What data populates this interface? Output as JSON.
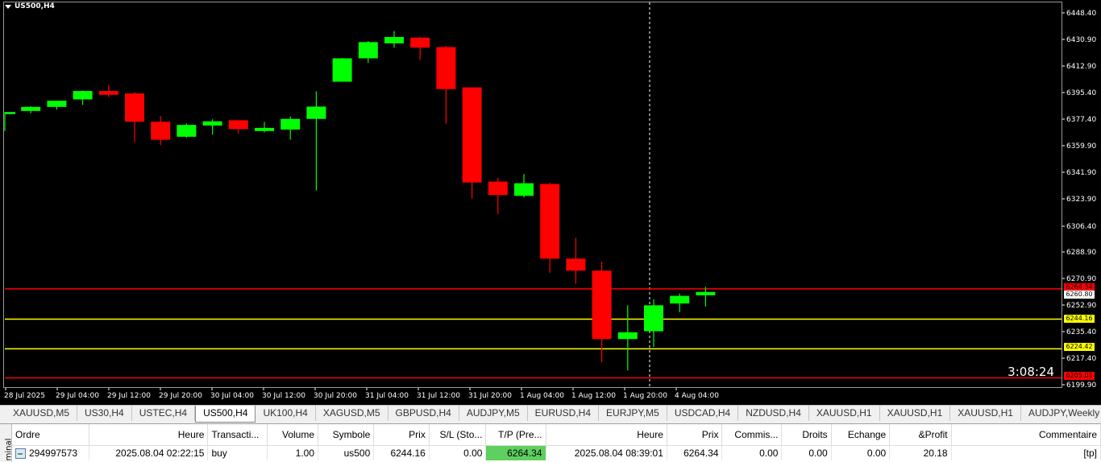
{
  "chart": {
    "symbol_label": "US500,H4",
    "timer": "3:08:24",
    "colors": {
      "bull": "#00ff00",
      "bear": "#ff0000",
      "tp_line": "#ff0000",
      "entry_line": "#ffff00",
      "bg": "#000000",
      "grid_text": "#ffffff"
    },
    "price_axis": [
      "6448.40",
      "6430.90",
      "6412.90",
      "6395.40",
      "6377.40",
      "6359.90",
      "6341.90",
      "6323.90",
      "6306.40",
      "6288.90",
      "6270.90",
      "6252.90",
      "6235.40",
      "6217.40",
      "6199.90"
    ],
    "time_axis": [
      "28 Jul 2025",
      "29 Jul 04:00",
      "29 Jul 12:00",
      "29 Jul 20:00",
      "30 Jul 04:00",
      "30 Jul 12:00",
      "30 Jul 20:00",
      "31 Jul 04:00",
      "31 Jul 12:00",
      "31 Jul 20:00",
      "1 Aug 04:00",
      "1 Aug 12:00",
      "1 Aug 20:00",
      "4 Aug 04:00"
    ],
    "price_tags": {
      "tp": "6264.34",
      "current": "6260.80",
      "entry": "6244.16",
      "level2": "6224.42",
      "sl": "6205.01"
    },
    "chart_data": {
      "type": "candlestick",
      "candles": [
        {
          "o": 6380.9,
          "h": 6382.1,
          "l": 6369.7,
          "c": 6382.3
        },
        {
          "o": 6383.0,
          "h": 6386.1,
          "l": 6381.5,
          "c": 6385.7
        },
        {
          "o": 6385.7,
          "h": 6388.9,
          "l": 6383.9,
          "c": 6389.8
        },
        {
          "o": 6390.7,
          "h": 6396.6,
          "l": 6387.0,
          "c": 6396.3
        },
        {
          "o": 6396.3,
          "h": 6400.4,
          "l": 6392.2,
          "c": 6393.8
        },
        {
          "o": 6394.7,
          "h": 6395.6,
          "l": 6362.1,
          "c": 6375.8
        },
        {
          "o": 6375.8,
          "h": 6379.7,
          "l": 6360.2,
          "c": 6363.8
        },
        {
          "o": 6365.8,
          "h": 6374.6,
          "l": 6365.2,
          "c": 6373.7
        },
        {
          "o": 6373.3,
          "h": 6377.4,
          "l": 6367.2,
          "c": 6376.1
        },
        {
          "o": 6376.8,
          "h": 6376.5,
          "l": 6368.0,
          "c": 6370.9
        },
        {
          "o": 6369.6,
          "h": 6375.7,
          "l": 6368.7,
          "c": 6371.7
        },
        {
          "o": 6370.6,
          "h": 6379.4,
          "l": 6363.9,
          "c": 6377.7
        },
        {
          "o": 6377.7,
          "h": 6396.1,
          "l": 6330.0,
          "c": 6385.9
        },
        {
          "o": 6402.5,
          "h": 6418.3,
          "l": 6403.7,
          "c": 6418.1
        },
        {
          "o": 6418.1,
          "h": 6429.6,
          "l": 6415.1,
          "c": 6428.9
        },
        {
          "o": 6428.1,
          "h": 6436.3,
          "l": 6425.3,
          "c": 6432.3
        },
        {
          "o": 6431.9,
          "h": 6432.4,
          "l": 6417.1,
          "c": 6425.2
        },
        {
          "o": 6425.6,
          "h": 6426.4,
          "l": 6374.5,
          "c": 6397.6
        },
        {
          "o": 6398.7,
          "h": 6398.2,
          "l": 6324.5,
          "c": 6335.3
        },
        {
          "o": 6335.9,
          "h": 6338.5,
          "l": 6314.2,
          "c": 6326.9
        },
        {
          "o": 6326.4,
          "h": 6340.9,
          "l": 6325.4,
          "c": 6334.8
        },
        {
          "o": 6334.3,
          "h": 6335.2,
          "l": 6275.1,
          "c": 6284.5
        },
        {
          "o": 6284.5,
          "h": 6298.4,
          "l": 6267.6,
          "c": 6276.5
        },
        {
          "o": 6276.5,
          "h": 6282.6,
          "l": 6215.5,
          "c": 6230.9
        },
        {
          "o": 6230.9,
          "h": 6253.4,
          "l": 6210.0,
          "c": 6235.4
        },
        {
          "o": 6236.1,
          "h": 6257.5,
          "l": 6225.6,
          "c": 6253.4
        },
        {
          "o": 6254.6,
          "h": 6261.2,
          "l": 6248.8,
          "c": 6259.7
        },
        {
          "o": 6260.1,
          "h": 6265.8,
          "l": 6252.6,
          "c": 6262.3
        }
      ],
      "lines": {
        "tp": 6264.34,
        "entry": 6244.16,
        "level2": 6224.42,
        "sl": 6205.01
      },
      "ylim": [
        6199.9,
        6448.4
      ]
    }
  },
  "tabs": [
    "XAUUSD,M5",
    "US30,H4",
    "USTEC,H4",
    "US500,H4",
    "UK100,H4",
    "XAGUSD,M5",
    "GBPUSD,H4",
    "AUDJPY,M5",
    "EURUSD,H4",
    "EURJPY,M5",
    "USDCAD,H4",
    "NZDUSD,H4",
    "XAUUSD,H1",
    "XAUUSD,H1",
    "XAUUSD,H1",
    "AUDJPY,Weekly"
  ],
  "active_tab": 3,
  "terminal": {
    "side_label": "minal",
    "headers": [
      "Ordre",
      "Heure",
      "Transacti...",
      "Volume",
      "Symbole",
      "Prix",
      "S/L (Sto...",
      "T/P (Pre...",
      "Heure",
      "Prix",
      "Commis...",
      "Droits",
      "Echange",
      "&Profit",
      "Commentaire"
    ],
    "row": [
      "294997573",
      "2025.08.04 02:22:15",
      "buy",
      "1.00",
      "us500",
      "6244.16",
      "0.00",
      "6264.34",
      "2025.08.04 08:39:01",
      "6264.34",
      "0.00",
      "0.00",
      "0.00",
      "20.18",
      "[tp]"
    ]
  }
}
